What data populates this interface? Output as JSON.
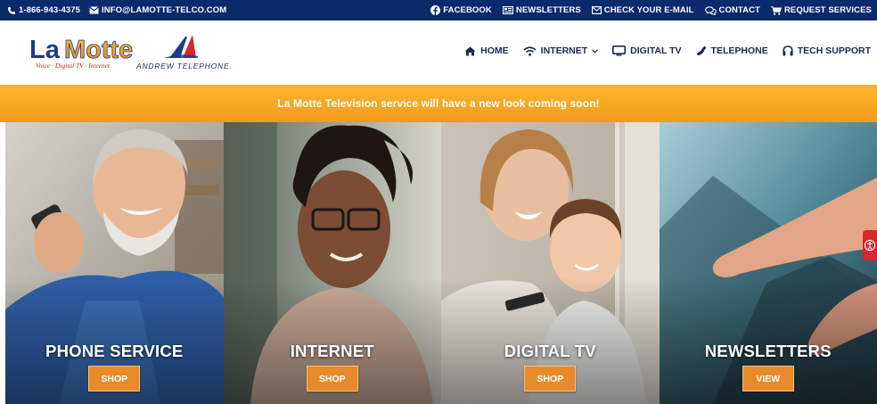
{
  "topbar": {
    "phone": "1-866-943-4375",
    "email": "INFO@LAMOTTE-TELCO.COM",
    "links": {
      "facebook": "FACEBOOK",
      "newsletters": "NEWSLETTERS",
      "check_email": "CHECK YOUR E-MAIL",
      "contact": "CONTACT",
      "request": "REQUEST SERVICES"
    }
  },
  "header": {
    "logo_text": "LaMotte",
    "logo_tagline": "Voice · Digital TV · Internet",
    "partner_name": "ANDREW TELEPHONE.",
    "nav": {
      "home": "HOME",
      "internet": "INTERNET",
      "digital_tv": "DIGITAL TV",
      "telephone": "TELEPHONE",
      "tech_support": "TECH SUPPORT"
    }
  },
  "banner": {
    "text": "La Motte Television service will have a new look coming soon!"
  },
  "panels": [
    {
      "title": "PHONE SERVICE",
      "button": "SHOP"
    },
    {
      "title": "INTERNET",
      "button": "SHOP"
    },
    {
      "title": "DIGITAL TV",
      "button": "SHOP"
    },
    {
      "title": "NEWSLETTERS",
      "button": "VIEW"
    }
  ],
  "colors": {
    "topbar": "#0b2a6b",
    "banner": "#f7a522",
    "button": "#e88a2a",
    "nav_text": "#1b2a4e",
    "accessibility": "#d7262c"
  }
}
